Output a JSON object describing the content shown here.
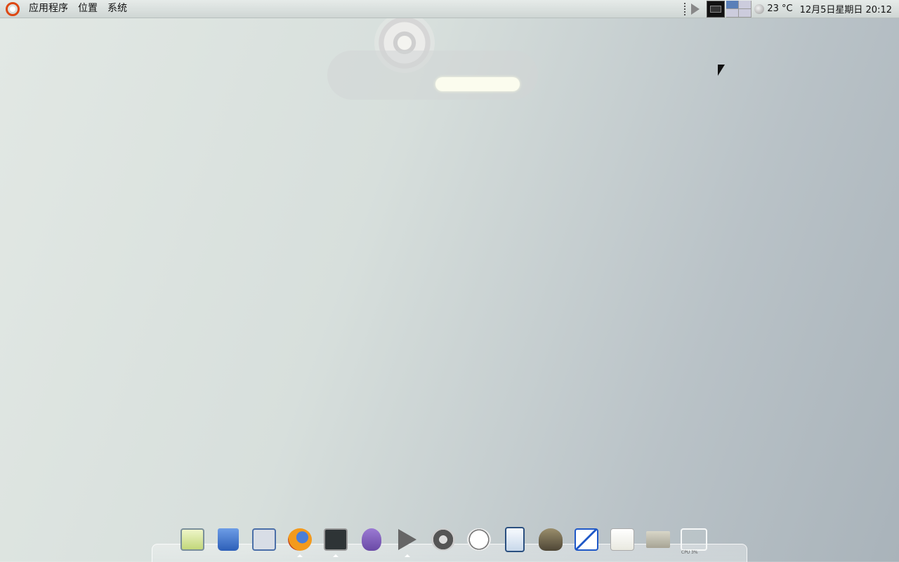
{
  "top_panel": {
    "menus": [
      "应用程序",
      "位置",
      "系统"
    ],
    "temperature": "23 °C",
    "datetime": "12月5日星期日  20:12"
  },
  "dock": {
    "items": [
      {
        "name": "notes-icon",
        "running": false
      },
      {
        "name": "trash-icon",
        "running": false
      },
      {
        "name": "save-floppy-icon",
        "running": false
      },
      {
        "name": "firefox-icon",
        "running": true
      },
      {
        "name": "terminal-icon",
        "running": true
      },
      {
        "name": "pidgin-icon",
        "running": false
      },
      {
        "name": "media-player-icon",
        "running": true
      },
      {
        "name": "video-editor-icon",
        "running": false
      },
      {
        "name": "clock-icon",
        "running": false
      },
      {
        "name": "document-viewer-icon",
        "running": false
      },
      {
        "name": "gimp-icon",
        "running": false
      },
      {
        "name": "drawing-icon",
        "running": false
      },
      {
        "name": "text-editor-icon",
        "running": false
      },
      {
        "name": "folder-icon",
        "running": false
      }
    ],
    "cpu_monitor_label": "CPU 3%"
  },
  "colors": {
    "panel_background": "#dfe5e3",
    "ubuntu_orange": "#dd4814",
    "active_workspace": "#5a7fb8"
  }
}
